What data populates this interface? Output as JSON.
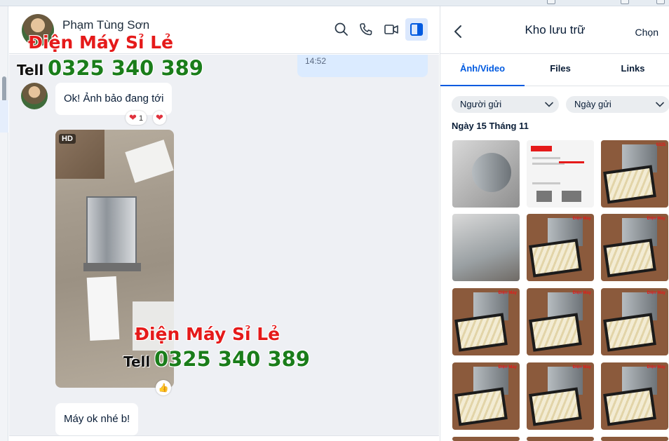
{
  "chat": {
    "contact_name": "Phạm Tùng Sơn",
    "sent_time": "14:52",
    "messages": [
      {
        "text": "Ok! Ảnh bảo đang tới",
        "reaction_count": "1"
      },
      {
        "text": "Máy ok nhé b!"
      }
    ],
    "photo_badge": "HD"
  },
  "watermark": {
    "brand": "Điện Máy Sỉ Lẻ",
    "tell_label": "Tell",
    "phone": "0325 340 389"
  },
  "storage": {
    "title": "Kho lưu trữ",
    "choose_label": "Chọn",
    "tabs": [
      "Ảnh/Video",
      "Files",
      "Links"
    ],
    "active_tab": "Ảnh/Video",
    "filters": [
      "Người gửi",
      "Ngày gửi"
    ],
    "date_group": "Ngày 15 Tháng 11"
  },
  "colors": {
    "accent": "#005ae0",
    "watermark_red": "#e51a1a",
    "watermark_green": "#1a7d1a",
    "outgoing_bubble": "#dbebff"
  },
  "icons": [
    "search-icon",
    "phone-icon",
    "video-call-icon",
    "sidebar-toggle-icon",
    "back-icon",
    "chevron-down-icon",
    "heart-icon",
    "like-icon"
  ]
}
